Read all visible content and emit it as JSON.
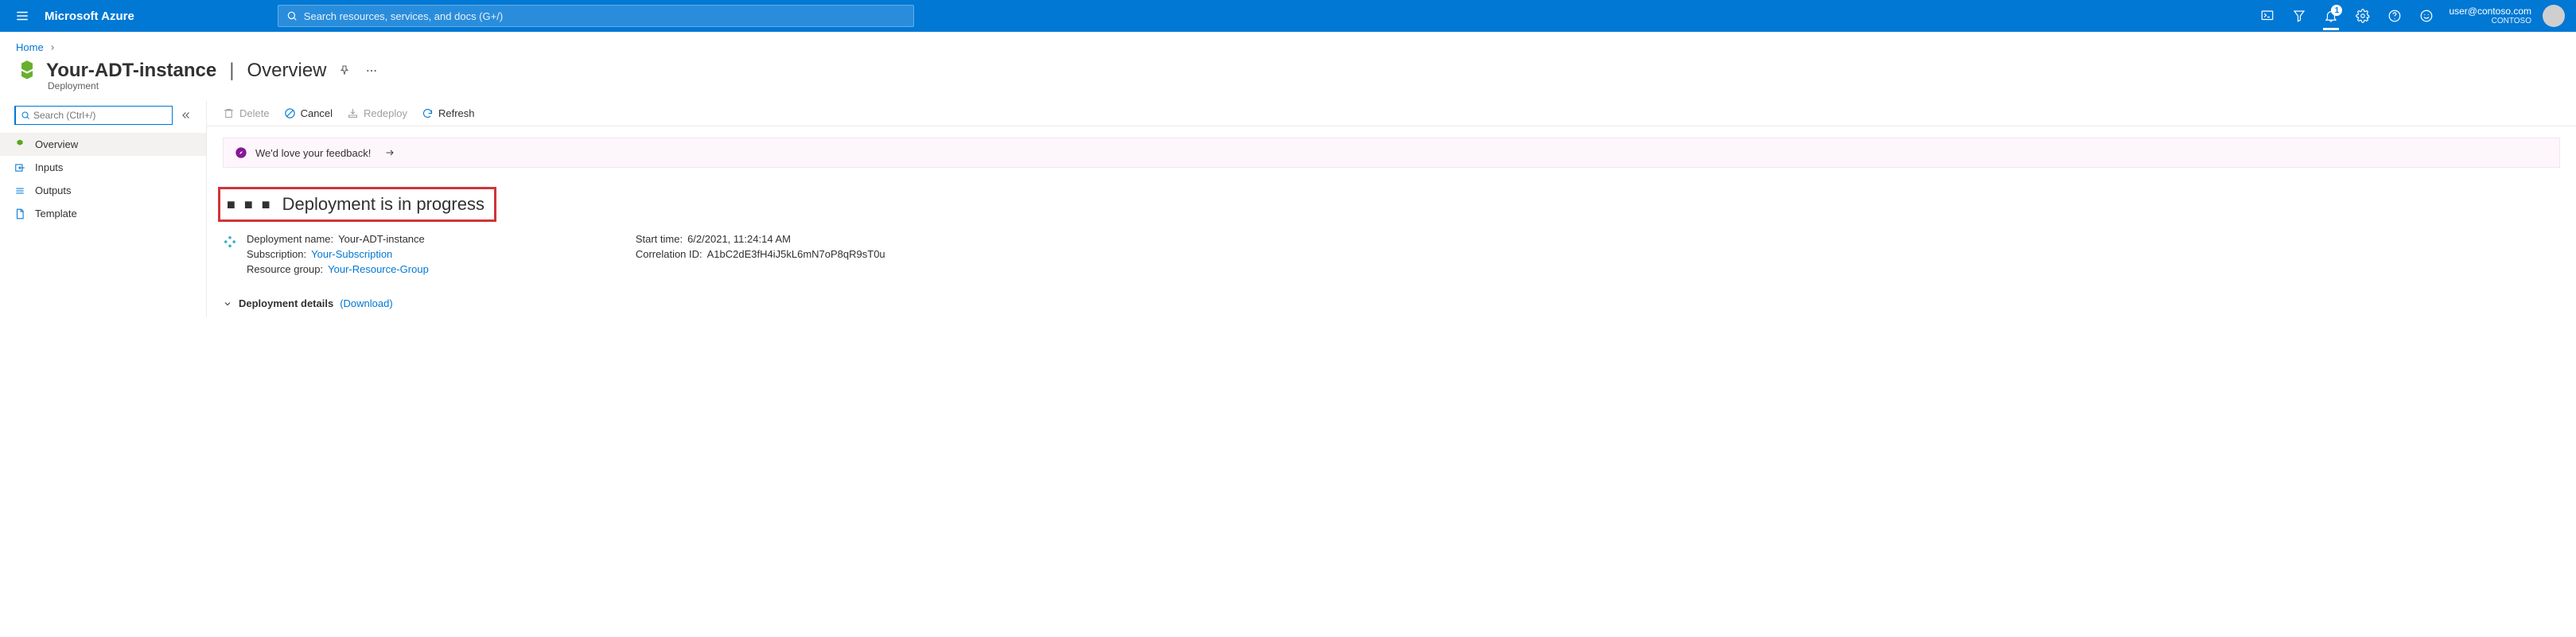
{
  "topbar": {
    "brand": "Microsoft Azure",
    "search_placeholder": "Search resources, services, and docs (G+/)",
    "notification_count": "1",
    "account_email": "user@contoso.com",
    "account_dir": "CONTOSO"
  },
  "breadcrumb": {
    "home": "Home"
  },
  "title": {
    "resource_name": "Your-ADT-instance",
    "section": "Overview",
    "subtitle": "Deployment"
  },
  "sidebar": {
    "search_placeholder": "Search (Ctrl+/)",
    "items": [
      {
        "label": "Overview",
        "color": "#58a618"
      },
      {
        "label": "Inputs",
        "color": "#0078d4"
      },
      {
        "label": "Outputs",
        "color": "#0078d4"
      },
      {
        "label": "Template",
        "color": "#0078d4"
      }
    ]
  },
  "toolbar": {
    "delete": "Delete",
    "cancel": "Cancel",
    "redeploy": "Redeploy",
    "refresh": "Refresh"
  },
  "feedback": {
    "text": "We'd love your feedback!"
  },
  "status": {
    "text": "Deployment is in progress"
  },
  "meta": {
    "left": {
      "deployment_name_label": "Deployment name:",
      "deployment_name_value": "Your-ADT-instance",
      "subscription_label": "Subscription:",
      "subscription_value": "Your-Subscription",
      "resource_group_label": "Resource group:",
      "resource_group_value": "Your-Resource-Group"
    },
    "right": {
      "start_time_label": "Start time:",
      "start_time_value": "6/2/2021, 11:24:14 AM",
      "correlation_label": "Correlation ID:",
      "correlation_value": "A1bC2dE3fH4iJ5kL6mN7oP8qR9sT0u"
    }
  },
  "details": {
    "label": "Deployment details",
    "download": "(Download)"
  }
}
